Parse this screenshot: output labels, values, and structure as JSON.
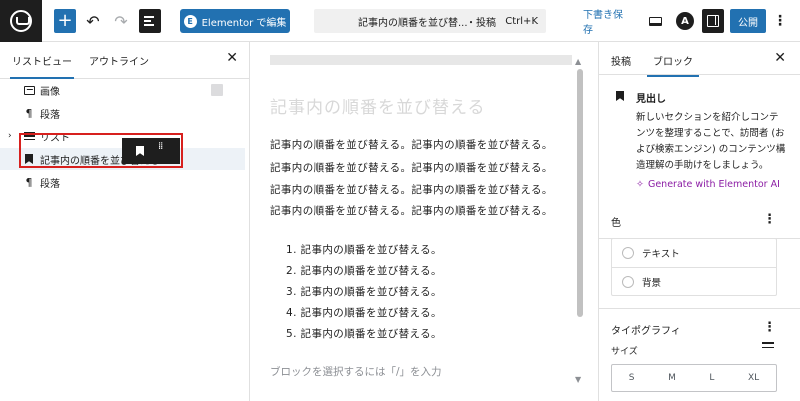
{
  "toolbar": {
    "add_block": "+",
    "undo": "↶",
    "redo": "↷",
    "elementor_button": "Elementor で編集",
    "elementor_icon_letter": "E",
    "command": {
      "title": "記事内の順番を並び替...",
      "type": "・投稿",
      "shortcut": "Ctrl+K"
    },
    "save_draft": "下書き保存",
    "astra_letter": "A",
    "publish": "公開",
    "more": "⋮"
  },
  "left_panel": {
    "tabs": [
      "リストビュー",
      "アウトライン"
    ],
    "close": "✕",
    "items": [
      {
        "label": "画像",
        "icon": "image-icon"
      },
      {
        "label": "段落",
        "icon": "paragraph-icon"
      },
      {
        "label": "リスト",
        "icon": "list-icon"
      },
      {
        "label": "記事内の順番を並び替える",
        "icon": "bookmark-icon"
      },
      {
        "label": "段落",
        "icon": "paragraph-icon"
      }
    ],
    "paragraph_glyph": "¶",
    "expand_glyph": "›"
  },
  "editor": {
    "heading": "記事内の順番を並び替える",
    "paragraphs": [
      "記事内の順番を並び替える。記事内の順番を並び替える。",
      "記事内の順番を並び替える。記事内の順番を並び替える。",
      "記事内の順番を並び替える。記事内の順番を並び替える。",
      "記事内の順番を並び替える。記事内の順番を並び替える。"
    ],
    "list": [
      "1. 記事内の順番を並び替える。",
      "2. 記事内の順番を並び替える。",
      "3. 記事内の順番を並び替える。",
      "4. 記事内の順番を並び替える。",
      "5. 記事内の順番を並び替える。"
    ],
    "placeholder": "ブロックを選択するには「/」を入力",
    "scroll_up": "▲",
    "scroll_down": "▼"
  },
  "right_panel": {
    "tabs": [
      "投稿",
      "ブロック"
    ],
    "close": "✕",
    "block": {
      "name": "見出し",
      "description": "新しいセクションを紹介しコンテンツを整理することで、訪問者 (および検索エンジン) のコンテンツ構造理解の手助けをしましょう。",
      "ai_link": "Generate with Elementor AI",
      "ai_icon": "✧"
    },
    "color": {
      "title": "色",
      "more": "⋮",
      "items": [
        "テキスト",
        "背景"
      ]
    },
    "typography": {
      "title": "タイポグラフィ",
      "more": "⋮",
      "size_label": "サイズ",
      "sizes": [
        "S",
        "M",
        "L",
        "XL"
      ]
    }
  }
}
